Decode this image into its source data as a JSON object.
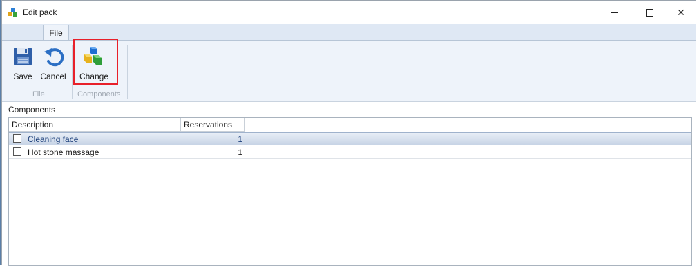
{
  "window": {
    "title": "Edit pack",
    "minimize_icon": "minimize-icon",
    "maximize_icon": "maximize-icon",
    "close_glyph": "✕"
  },
  "ribbon": {
    "tabs": [
      {
        "label": "File"
      }
    ],
    "buttons": {
      "save": {
        "label": "Save",
        "icon": "floppy-disk-icon"
      },
      "cancel": {
        "label": "Cancel",
        "icon": "undo-arrow-icon"
      },
      "change": {
        "label": "Change",
        "icon": "colored-cubes-icon"
      }
    },
    "groups": {
      "file": "File",
      "components": "Components"
    }
  },
  "components": {
    "section_label": "Components",
    "columns": {
      "description": "Description",
      "reservations": "Reservations"
    },
    "rows": [
      {
        "description": "Cleaning face",
        "reservations": "1",
        "checked": false,
        "selected": true
      },
      {
        "description": "Hot stone massage",
        "reservations": "1",
        "checked": false,
        "selected": false
      }
    ]
  },
  "colors": {
    "highlight": "#e8202a",
    "ribbon_bg": "#eef3fa",
    "selected_row": "#c7d4e6"
  }
}
